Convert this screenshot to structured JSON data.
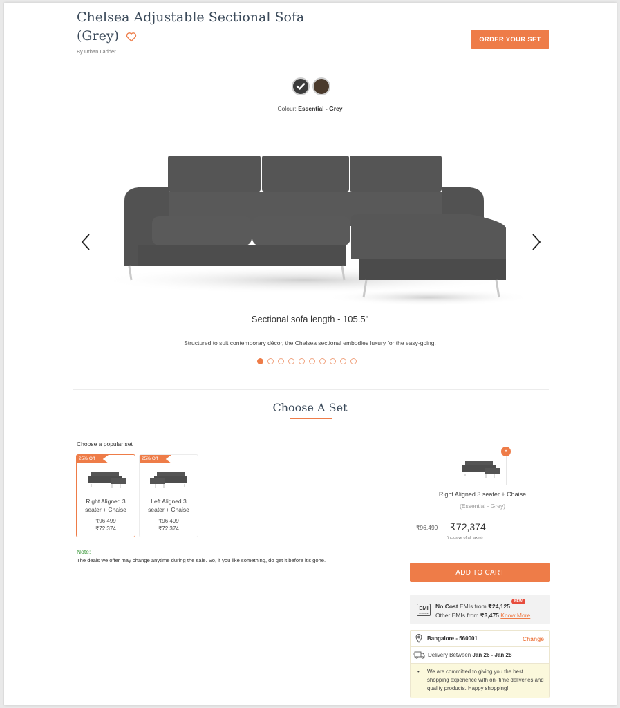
{
  "product": {
    "title": "Chelsea Adjustable Sectional Sofa (Grey)",
    "brand": "By Urban Ladder",
    "wishlist_icon": "heart-outline-icon",
    "order_button": "ORDER YOUR SET"
  },
  "colour": {
    "options": [
      {
        "name": "Essential - Grey",
        "hex": "#3c3c3c",
        "selected": true
      },
      {
        "name": "Brown",
        "hex": "#4a3a2c",
        "selected": false
      }
    ],
    "label_prefix": "Colour: ",
    "selected_name": "Essential - Grey"
  },
  "gallery": {
    "caption": "Sectional sofa length - 105.5\"",
    "description": "Structured to suit contemporary décor, the Chelsea sectional embodies luxury for the easy-going.",
    "slide_count": 10,
    "active_slide": 1,
    "prev_icon": "chevron-left-icon",
    "next_icon": "chevron-right-icon"
  },
  "choose_set": {
    "title": "Choose A Set",
    "popular_label": "Choose a popular set",
    "sets": [
      {
        "badge": "25% Off",
        "name": "Right Aligned 3 seater + Chaise",
        "old_price": "₹96,499",
        "price": "₹72,374",
        "selected": true
      },
      {
        "badge": "25% Off",
        "name": "Left Aligned 3 seater + Chaise",
        "old_price": "₹96,499",
        "price": "₹72,374",
        "selected": false
      }
    ],
    "note_label": "Note:",
    "note_text": "The deals we offer may change anytime during the sale. So, if you like something, do get it before it's gone."
  },
  "summary": {
    "selected_name": "Right Aligned 3 seater + Chaise",
    "selected_variant": "(Essential - Grey)",
    "remove_icon": "×",
    "old_price": "₹96,499",
    "price": "₹72,374",
    "tax_note": "(inclusive of all taxes)",
    "add_to_cart": "ADD TO CART",
    "emi": {
      "icon_text": "EMI",
      "icon_sub": "FINANCE",
      "no_cost_prefix": "No Cost",
      "no_cost_text": " EMIs from ",
      "no_cost_amount": "₹24,125",
      "badge": "NEW",
      "other_text": "Other EMIs from ",
      "other_amount": "₹3,475",
      "know_more": "Know More"
    },
    "location": {
      "city": "Bangalore - 560001",
      "change": "Change",
      "delivery_prefix": "Delivery Between ",
      "delivery_dates": "Jan 26 - Jan 28",
      "info": "We are committed to giving you the best shopping experience with on- time deliveries and quality products. Happy shopping!"
    }
  }
}
